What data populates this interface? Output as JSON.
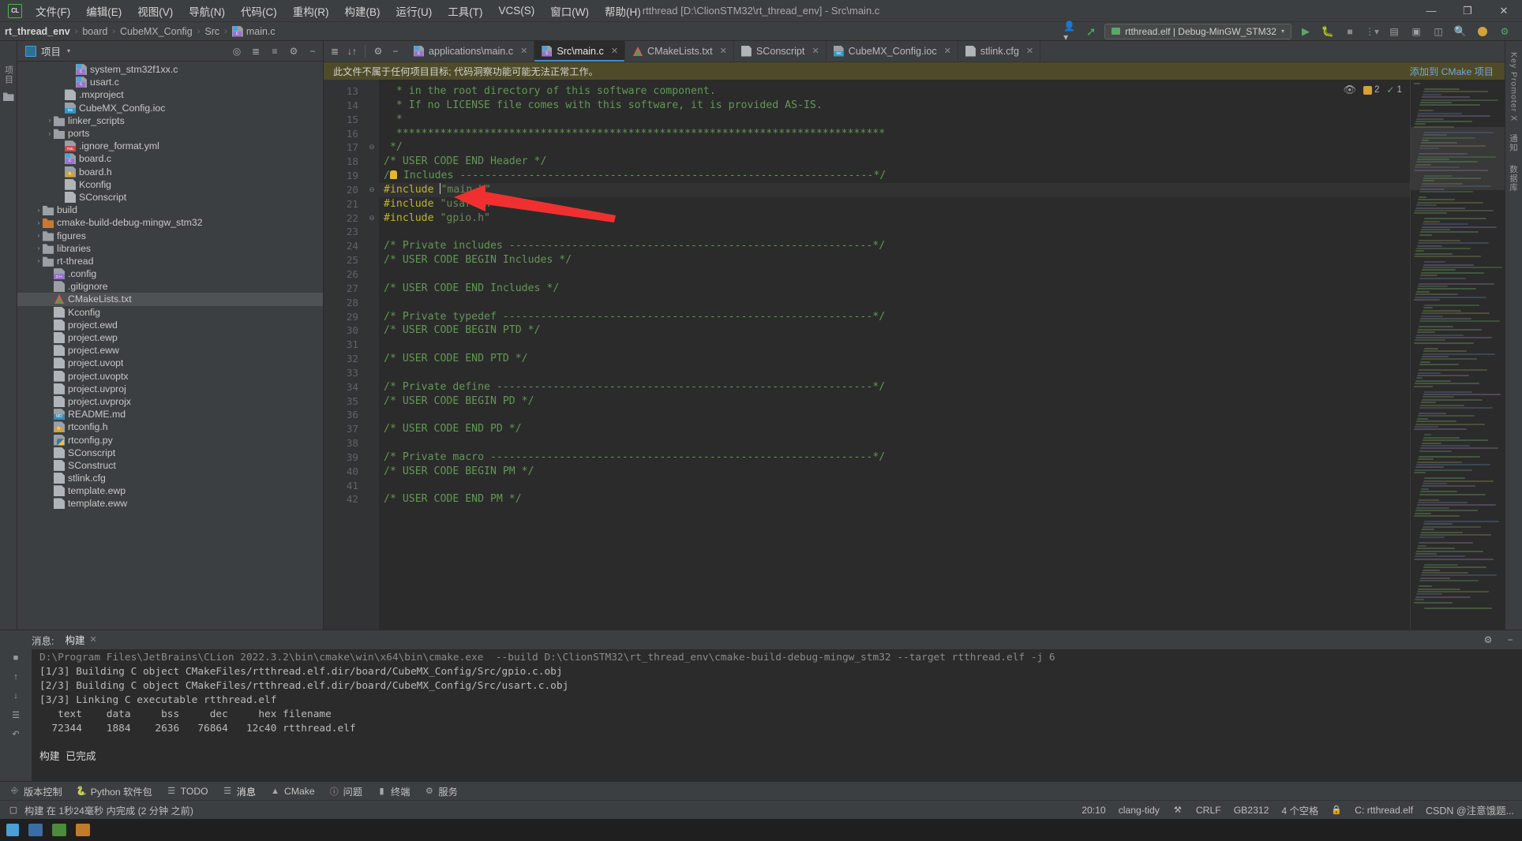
{
  "window": {
    "title": "rtthread [D:\\ClionSTM32\\rt_thread_env] - Src\\main.c",
    "minimize": "—",
    "maximize": "❐",
    "close": "✕"
  },
  "menu": {
    "logo": "CL",
    "items": [
      {
        "label": "文件(F)",
        "name": "menu-file"
      },
      {
        "label": "编辑(E)",
        "name": "menu-edit"
      },
      {
        "label": "视图(V)",
        "name": "menu-view"
      },
      {
        "label": "导航(N)",
        "name": "menu-navigate"
      },
      {
        "label": "代码(C)",
        "name": "menu-code"
      },
      {
        "label": "重构(R)",
        "name": "menu-refactor"
      },
      {
        "label": "构建(B)",
        "name": "menu-build"
      },
      {
        "label": "运行(U)",
        "name": "menu-run"
      },
      {
        "label": "工具(T)",
        "name": "menu-tools"
      },
      {
        "label": "VCS(S)",
        "name": "menu-vcs"
      },
      {
        "label": "窗口(W)",
        "name": "menu-window"
      },
      {
        "label": "帮助(H)",
        "name": "menu-help"
      }
    ]
  },
  "breadcrumb": {
    "items": [
      "rt_thread_env",
      "board",
      "CubeMX_Config",
      "Src",
      "main.c"
    ],
    "separator": "›"
  },
  "navbar_right": {
    "avatar_icon": "user-icon",
    "hammer_icon": "build-hammer-icon",
    "run_config": "rtthread.elf | Debug-MinGW_STM32",
    "run_icon": "run-icon",
    "debug_icon": "debug-icon",
    "stop_icon": "stop-icon",
    "more_icon": "more-icon",
    "search_icon": "search-icon",
    "settings_icon": "settings-icon",
    "updates_icon": "updates-icon"
  },
  "left_rail": {
    "project_label": "项目",
    "structure_icon": "structure-icon",
    "commit_icon": "commit-icon"
  },
  "right_rail": {
    "items": [
      "通知",
      "Key Promoter X",
      "数据库"
    ]
  },
  "project_panel": {
    "title": "项目",
    "caret": "▾",
    "icons": [
      "target-icon",
      "expand-icon",
      "collapse-icon",
      "settings-icon",
      "hide-icon"
    ],
    "tree": [
      {
        "label": "system_stm32f1xx.c",
        "indent": 4,
        "arrow": "",
        "icon": "c-file",
        "selected": false
      },
      {
        "label": "usart.c",
        "indent": 4,
        "arrow": "",
        "icon": "c-file",
        "selected": false
      },
      {
        "label": ".mxproject",
        "indent": 3,
        "arrow": "",
        "icon": "text-file",
        "selected": false
      },
      {
        "label": "CubeMX_Config.ioc",
        "indent": 3,
        "arrow": "",
        "icon": "ioc-file",
        "selected": false
      },
      {
        "label": "linker_scripts",
        "indent": 2,
        "arrow": "›",
        "icon": "folder",
        "selected": false
      },
      {
        "label": "ports",
        "indent": 2,
        "arrow": "›",
        "icon": "folder",
        "selected": false
      },
      {
        "label": ".ignore_format.yml",
        "indent": 3,
        "arrow": "",
        "icon": "yml-file",
        "selected": false
      },
      {
        "label": "board.c",
        "indent": 3,
        "arrow": "",
        "icon": "c-file",
        "selected": false
      },
      {
        "label": "board.h",
        "indent": 3,
        "arrow": "",
        "icon": "h-file",
        "selected": false
      },
      {
        "label": "Kconfig",
        "indent": 3,
        "arrow": "",
        "icon": "text-file",
        "selected": false
      },
      {
        "label": "SConscript",
        "indent": 3,
        "arrow": "",
        "icon": "text-file",
        "selected": false
      },
      {
        "label": "build",
        "indent": 1,
        "arrow": "›",
        "icon": "folder",
        "selected": false
      },
      {
        "label": "cmake-build-debug-mingw_stm32",
        "indent": 1,
        "arrow": "›",
        "icon": "folder-orange",
        "selected": false
      },
      {
        "label": "figures",
        "indent": 1,
        "arrow": "›",
        "icon": "folder",
        "selected": false
      },
      {
        "label": "libraries",
        "indent": 1,
        "arrow": "›",
        "icon": "folder",
        "selected": false
      },
      {
        "label": "rt-thread",
        "indent": 1,
        "arrow": "›",
        "icon": "folder",
        "selected": false
      },
      {
        "label": ".config",
        "indent": 2,
        "arrow": "",
        "icon": "cpp-file",
        "selected": false
      },
      {
        "label": ".gitignore",
        "indent": 2,
        "arrow": "",
        "icon": "git-file",
        "selected": false
      },
      {
        "label": "CMakeLists.txt",
        "indent": 2,
        "arrow": "",
        "icon": "cmake-file",
        "selected": true
      },
      {
        "label": "Kconfig",
        "indent": 2,
        "arrow": "",
        "icon": "text-file",
        "selected": false
      },
      {
        "label": "project.ewd",
        "indent": 2,
        "arrow": "",
        "icon": "text-file",
        "selected": false
      },
      {
        "label": "project.ewp",
        "indent": 2,
        "arrow": "",
        "icon": "text-file",
        "selected": false
      },
      {
        "label": "project.eww",
        "indent": 2,
        "arrow": "",
        "icon": "text-file",
        "selected": false
      },
      {
        "label": "project.uvopt",
        "indent": 2,
        "arrow": "",
        "icon": "text-file",
        "selected": false
      },
      {
        "label": "project.uvoptx",
        "indent": 2,
        "arrow": "",
        "icon": "text-file",
        "selected": false
      },
      {
        "label": "project.uvproj",
        "indent": 2,
        "arrow": "",
        "icon": "text-file",
        "selected": false
      },
      {
        "label": "project.uvprojx",
        "indent": 2,
        "arrow": "",
        "icon": "text-file",
        "selected": false
      },
      {
        "label": "README.md",
        "indent": 2,
        "arrow": "",
        "icon": "md-file",
        "selected": false
      },
      {
        "label": "rtconfig.h",
        "indent": 2,
        "arrow": "",
        "icon": "h-file",
        "selected": false
      },
      {
        "label": "rtconfig.py",
        "indent": 2,
        "arrow": "",
        "icon": "py-file",
        "selected": false
      },
      {
        "label": "SConscript",
        "indent": 2,
        "arrow": "",
        "icon": "text-file",
        "selected": false
      },
      {
        "label": "SConstruct",
        "indent": 2,
        "arrow": "",
        "icon": "text-file",
        "selected": false
      },
      {
        "label": "stlink.cfg",
        "indent": 2,
        "arrow": "",
        "icon": "text-file",
        "selected": false
      },
      {
        "label": "template.ewp",
        "indent": 2,
        "arrow": "",
        "icon": "text-file",
        "selected": false
      },
      {
        "label": "template.eww",
        "indent": 2,
        "arrow": "",
        "icon": "text-file",
        "selected": false
      }
    ]
  },
  "editor": {
    "toolbar_icons": [
      "expand-all-icon",
      "collapse-all-icon",
      "settings-icon",
      "hide-icon"
    ],
    "tabs": [
      {
        "label": "applications\\main.c",
        "icon": "c-file",
        "active": false
      },
      {
        "label": "Src\\main.c",
        "icon": "c-file",
        "active": true
      },
      {
        "label": "CMakeLists.txt",
        "icon": "cmake-file",
        "active": false
      },
      {
        "label": "SConscript",
        "icon": "text-file",
        "active": false
      },
      {
        "label": "CubeMX_Config.ioc",
        "icon": "ioc-file",
        "active": false
      },
      {
        "label": "stlink.cfg",
        "icon": "text-file",
        "active": false
      }
    ],
    "notice": "此文件不属于任何项目目标; 代码洞察功能可能无法正常工作。",
    "notice_link": "添加到 CMake 项目",
    "inspection": {
      "eye_icon": "eye-icon",
      "warning_count": "2",
      "check_count": "1",
      "up_icon": "∧",
      "down_icon": "∨"
    },
    "first_line_number": 13,
    "lines": [
      {
        "n": 13,
        "fold": "",
        "segs": [
          {
            "t": "  * in the root directory of this software component.",
            "c": "cmt"
          }
        ]
      },
      {
        "n": 14,
        "fold": "",
        "segs": [
          {
            "t": "  * If no LICENSE file comes with this software, it is provided AS-IS.",
            "c": "cmt"
          }
        ]
      },
      {
        "n": 15,
        "fold": "",
        "segs": [
          {
            "t": "  *",
            "c": "cmt"
          }
        ]
      },
      {
        "n": 16,
        "fold": "",
        "segs": [
          {
            "t": "  ******************************************************************************",
            "c": "cmt"
          }
        ]
      },
      {
        "n": 17,
        "fold": "⊖",
        "segs": [
          {
            "t": " */",
            "c": "cmt"
          }
        ]
      },
      {
        "n": 18,
        "fold": "",
        "segs": [
          {
            "t": "/* USER CODE END Header */",
            "c": "cmt"
          }
        ]
      },
      {
        "n": 19,
        "fold": "",
        "segs": [
          {
            "t": "/",
            "c": "cmt"
          },
          {
            "t": "BULB",
            "c": "bulb"
          },
          {
            "t": " Includes ------------------------------------------------------------------*/",
            "c": "cmt"
          }
        ]
      },
      {
        "n": 20,
        "fold": "⊖",
        "segs": [
          {
            "t": "#include ",
            "c": "prep"
          },
          {
            "t": "CARET",
            "c": "caret"
          },
          {
            "t": "\"main.h\"",
            "c": "str"
          }
        ],
        "current": true
      },
      {
        "n": 21,
        "fold": "",
        "segs": [
          {
            "t": "#include ",
            "c": "prep"
          },
          {
            "t": "\"usart.h\"",
            "c": "str"
          }
        ]
      },
      {
        "n": 22,
        "fold": "⊖",
        "segs": [
          {
            "t": "#include ",
            "c": "prep"
          },
          {
            "t": "\"gpio.h\"",
            "c": "str"
          }
        ]
      },
      {
        "n": 23,
        "fold": "",
        "segs": [
          {
            "t": "",
            "c": "cmt"
          }
        ]
      },
      {
        "n": 24,
        "fold": "",
        "segs": [
          {
            "t": "/* Private includes ----------------------------------------------------------*/",
            "c": "cmt"
          }
        ]
      },
      {
        "n": 25,
        "fold": "",
        "segs": [
          {
            "t": "/* USER CODE BEGIN Includes */",
            "c": "cmt"
          }
        ]
      },
      {
        "n": 26,
        "fold": "",
        "segs": [
          {
            "t": "",
            "c": "cmt"
          }
        ]
      },
      {
        "n": 27,
        "fold": "",
        "segs": [
          {
            "t": "/* USER CODE END Includes */",
            "c": "cmt"
          }
        ]
      },
      {
        "n": 28,
        "fold": "",
        "segs": [
          {
            "t": "",
            "c": "cmt"
          }
        ]
      },
      {
        "n": 29,
        "fold": "",
        "segs": [
          {
            "t": "/* Private typedef -----------------------------------------------------------*/",
            "c": "cmt"
          }
        ]
      },
      {
        "n": 30,
        "fold": "",
        "segs": [
          {
            "t": "/* USER CODE BEGIN PTD */",
            "c": "cmt"
          }
        ]
      },
      {
        "n": 31,
        "fold": "",
        "segs": [
          {
            "t": "",
            "c": "cmt"
          }
        ]
      },
      {
        "n": 32,
        "fold": "",
        "segs": [
          {
            "t": "/* USER CODE END PTD */",
            "c": "cmt"
          }
        ]
      },
      {
        "n": 33,
        "fold": "",
        "segs": [
          {
            "t": "",
            "c": "cmt"
          }
        ]
      },
      {
        "n": 34,
        "fold": "",
        "segs": [
          {
            "t": "/* Private define ------------------------------------------------------------*/",
            "c": "cmt"
          }
        ]
      },
      {
        "n": 35,
        "fold": "",
        "segs": [
          {
            "t": "/* USER CODE BEGIN PD */",
            "c": "cmt"
          }
        ]
      },
      {
        "n": 36,
        "fold": "",
        "segs": [
          {
            "t": "",
            "c": "cmt"
          }
        ]
      },
      {
        "n": 37,
        "fold": "",
        "segs": [
          {
            "t": "/* USER CODE END PD */",
            "c": "cmt"
          }
        ]
      },
      {
        "n": 38,
        "fold": "",
        "segs": [
          {
            "t": "",
            "c": "cmt"
          }
        ]
      },
      {
        "n": 39,
        "fold": "",
        "segs": [
          {
            "t": "/* Private macro -------------------------------------------------------------*/",
            "c": "cmt"
          }
        ]
      },
      {
        "n": 40,
        "fold": "",
        "segs": [
          {
            "t": "/* USER CODE BEGIN PM */",
            "c": "cmt"
          }
        ]
      },
      {
        "n": 41,
        "fold": "",
        "segs": [
          {
            "t": "",
            "c": "cmt"
          }
        ]
      },
      {
        "n": 42,
        "fold": "",
        "segs": [
          {
            "t": "/* USER CODE END PM */",
            "c": "cmt"
          }
        ]
      }
    ]
  },
  "build_panel": {
    "message_label": "消息:",
    "tab_label": "构建",
    "tab_close": "✕",
    "settings_icon": "settings-icon",
    "hide_icon": "hide-icon",
    "rail_icons": [
      "stop-icon",
      "up-icon",
      "down-icon",
      "filter-icon",
      "soft-wrap-icon"
    ],
    "lines": [
      "D:\\Program Files\\JetBrains\\CLion 2022.3.2\\bin\\cmake\\win\\x64\\bin\\cmake.exe  --build D:\\ClionSTM32\\rt_thread_env\\cmake-build-debug-mingw_stm32 --target rtthread.elf -j 6",
      "[1/3] Building C object CMakeFiles/rtthread.elf.dir/board/CubeMX_Config/Src/gpio.c.obj",
      "[2/3] Building C object CMakeFiles/rtthread.elf.dir/board/CubeMX_Config/Src/usart.c.obj",
      "[3/3] Linking C executable rtthread.elf",
      "   text    data     bss     dec     hex filename",
      "  72344    1884    2636   76864   12c40 rtthread.elf",
      "",
      "构建 已完成"
    ]
  },
  "toolstrip": {
    "items": [
      {
        "label": "版本控制",
        "icon": "vcs-icon",
        "name": "tool-vcs"
      },
      {
        "label": "Python 软件包",
        "icon": "python-icon",
        "name": "tool-python-packages"
      },
      {
        "label": "TODO",
        "icon": "todo-icon",
        "name": "tool-todo"
      },
      {
        "label": "消息",
        "icon": "messages-icon",
        "name": "tool-messages"
      },
      {
        "label": "CMake",
        "icon": "cmake-icon",
        "name": "tool-cmake"
      },
      {
        "label": "问题",
        "icon": "problems-icon",
        "name": "tool-problems"
      },
      {
        "label": "终端",
        "icon": "terminal-icon",
        "name": "tool-terminal"
      },
      {
        "label": "服务",
        "icon": "services-icon",
        "name": "tool-services"
      }
    ]
  },
  "status_bar": {
    "build_message": "构建 在 1秒24毫秒 内完成 (2 分钟 之前)",
    "caret_position": "20:10",
    "clang_tidy": "clang-tidy",
    "analysis_icon": "analysis-icon",
    "line_separator": "CRLF",
    "encoding": "GB2312",
    "indent": "4 个空格",
    "git_branch": "rtthread.elf",
    "git_prefix": "C:",
    "lock_icon": "lock-icon",
    "watermark": "CSDN @注意饿题..."
  }
}
